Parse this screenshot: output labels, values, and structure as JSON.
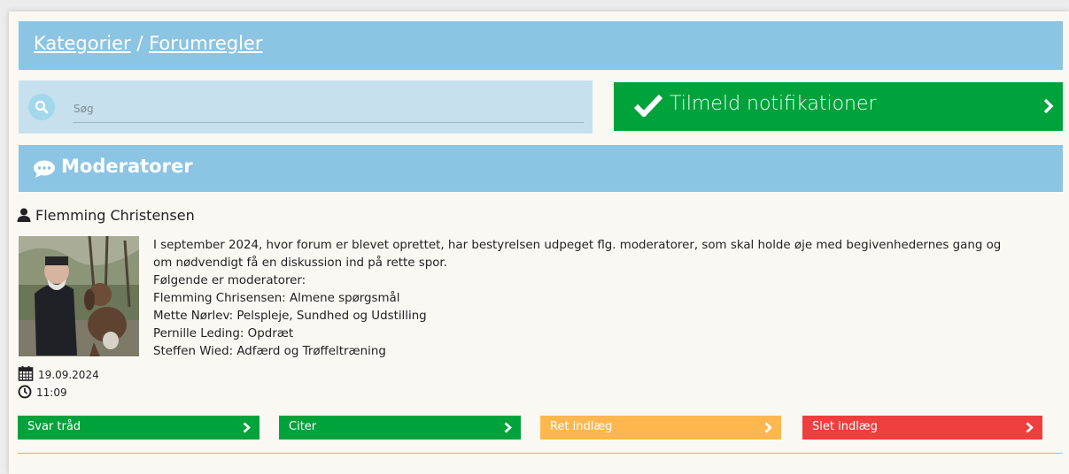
{
  "breadcrumb": {
    "categories": "Kategorier",
    "separator": "/",
    "current": "Forumregler"
  },
  "search": {
    "placeholder": "Søg"
  },
  "notify": {
    "label": "Tilmeld notifikationer"
  },
  "section": {
    "title": "Moderatorer"
  },
  "post": {
    "author": "Flemming Christensen",
    "date": "19.09.2024",
    "time": "11:09",
    "body": [
      "I september 2024, hvor forum er blevet oprettet, har bestyrelsen udpeget flg. moderatorer, som skal holde øje med begivenhedernes gang og",
      "om nødvendigt få en diskussion ind på rette spor.",
      "Følgende er moderatorer:",
      "Flemming Chrisensen: Almene spørgsmål",
      "Mette Nørlev: Pelspleje, Sundhed og Udstilling",
      "Pernille Leding: Opdræt",
      "Steffen Wied: Adfærd og Trøffeltræning"
    ]
  },
  "actions": {
    "reply": "Svar tråd",
    "quote": "Citer",
    "edit": "Ret indlæg",
    "delete": "Slet indlæg"
  },
  "colors": {
    "header_blue": "#8cc4e3",
    "search_bg": "#c6e0ed",
    "green": "#00a33b",
    "orange": "#fdb74e",
    "red": "#ef3e3e",
    "page_bg": "#faf8f3"
  },
  "icons": {
    "search": "search-icon",
    "check": "checkmark-icon",
    "chevron": "chevron-right-icon",
    "chat": "chat-bubble-icon",
    "user": "user-icon",
    "calendar": "calendar-icon",
    "clock": "clock-icon"
  }
}
